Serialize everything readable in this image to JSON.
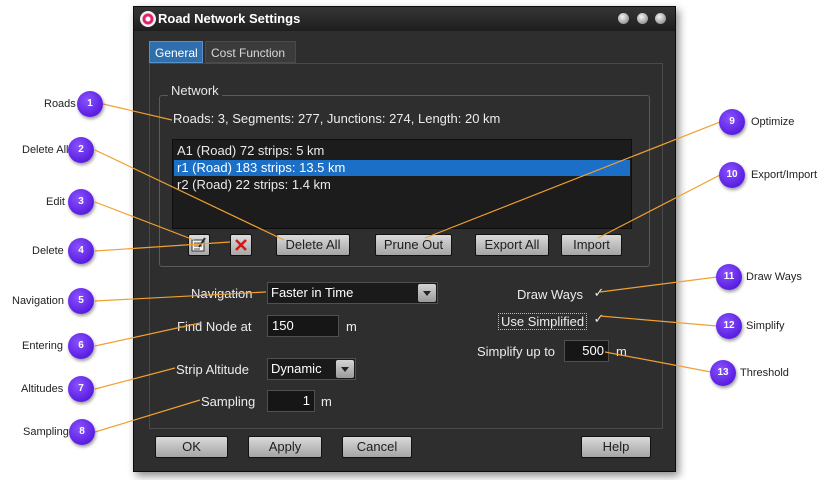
{
  "window": {
    "title": "Road Network Settings"
  },
  "tabs": [
    {
      "label": "General",
      "active": true
    },
    {
      "label": "Cost Function",
      "active": false
    }
  ],
  "network": {
    "group_title": "Network",
    "summary": "Roads: 3, Segments: 277, Junctions: 274, Length: 20 km",
    "roads": [
      {
        "label": "A1 (Road) 72 strips: 5 km",
        "selected": false
      },
      {
        "label": "r1 (Road) 183 strips: 13.5 km",
        "selected": true
      },
      {
        "label": "r2 (Road) 22 strips: 1.4 km",
        "selected": false
      }
    ],
    "edit_icon": "edit-icon",
    "delete_icon": "red-x-delete-icon",
    "delete_all_label": "Delete All",
    "prune_out_label": "Prune Out",
    "export_all_label": "Export All",
    "import_label": "Import"
  },
  "settings": {
    "navigation_label": "Navigation",
    "navigation_value": "Faster in Time",
    "find_node_label": "Find Node at",
    "find_node_value": "150",
    "find_node_unit": "m",
    "strip_altitude_label": "Strip Altitude",
    "strip_altitude_value": "Dynamic",
    "sampling_label": "Sampling",
    "sampling_value": "1",
    "sampling_unit": "m",
    "draw_ways_label": "Draw Ways",
    "draw_ways_checked": true,
    "use_simplified_label": "Use Simplified",
    "use_simplified_checked": true,
    "simplify_up_to_label": "Simplify up to",
    "simplify_up_to_value": "500",
    "simplify_up_to_unit": "m"
  },
  "footer": {
    "ok": "OK",
    "apply": "Apply",
    "cancel": "Cancel",
    "help": "Help"
  },
  "callouts": [
    {
      "num": "1",
      "label": "Roads"
    },
    {
      "num": "2",
      "label": "Delete All"
    },
    {
      "num": "3",
      "label": "Edit"
    },
    {
      "num": "4",
      "label": "Delete"
    },
    {
      "num": "5",
      "label": "Navigation"
    },
    {
      "num": "6",
      "label": "Entering"
    },
    {
      "num": "7",
      "label": "Altitudes"
    },
    {
      "num": "8",
      "label": "Sampling"
    },
    {
      "num": "9",
      "label": "Optimize"
    },
    {
      "num": "10",
      "label": "Export/Import"
    },
    {
      "num": "11",
      "label": "Draw Ways"
    },
    {
      "num": "12",
      "label": "Simplify"
    },
    {
      "num": "13",
      "label": "Threshold"
    }
  ],
  "colors": {
    "accent": "#1c6fc7",
    "callout": "#6a32f0",
    "leader": "#f0a030",
    "background": "#2e2e2e"
  }
}
